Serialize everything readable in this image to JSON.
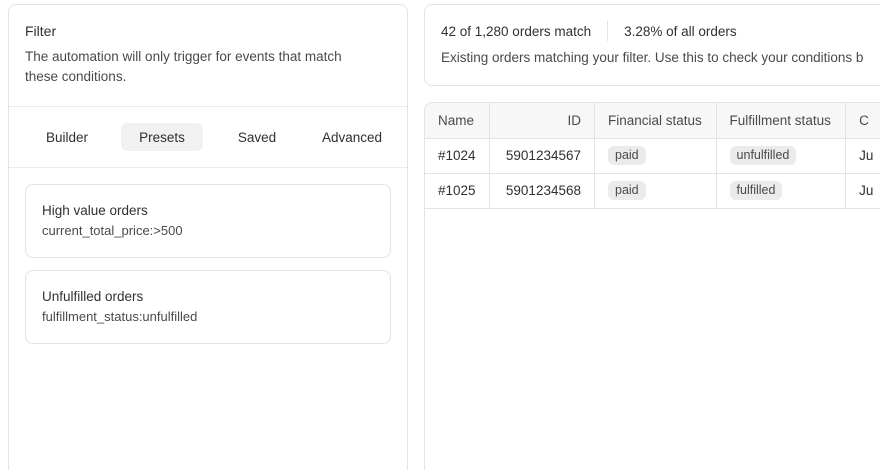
{
  "filter": {
    "title": "Filter",
    "description": "The automation will only trigger for events that match these conditions."
  },
  "tabs": [
    {
      "label": "Builder",
      "active": false
    },
    {
      "label": "Presets",
      "active": true
    },
    {
      "label": "Saved",
      "active": false
    },
    {
      "label": "Advanced",
      "active": false
    }
  ],
  "presets": [
    {
      "name": "High value orders",
      "query": "current_total_price:>500"
    },
    {
      "name": "Unfulfilled orders",
      "query": "fulfillment_status:unfulfilled"
    }
  ],
  "summary": {
    "match_count": "42 of 1,280 orders match",
    "match_percent": "3.28% of all orders",
    "description": "Existing orders matching your filter. Use this to check your conditions b"
  },
  "table": {
    "columns": [
      "Name",
      "ID",
      "Financial status",
      "Fulfillment status",
      "C"
    ],
    "rows": [
      {
        "name": "#1024",
        "id": "5901234567",
        "financial_status": "paid",
        "fulfillment_status": "unfulfilled",
        "c": "Ju"
      },
      {
        "name": "#1025",
        "id": "5901234568",
        "financial_status": "paid",
        "fulfillment_status": "fulfilled",
        "c": "Ju"
      }
    ]
  },
  "colors": {
    "border": "#e3e3e3",
    "active_tab_bg": "#f1f1f1",
    "badge_bg": "#ebebeb",
    "header_bg": "#f7f7f7"
  }
}
